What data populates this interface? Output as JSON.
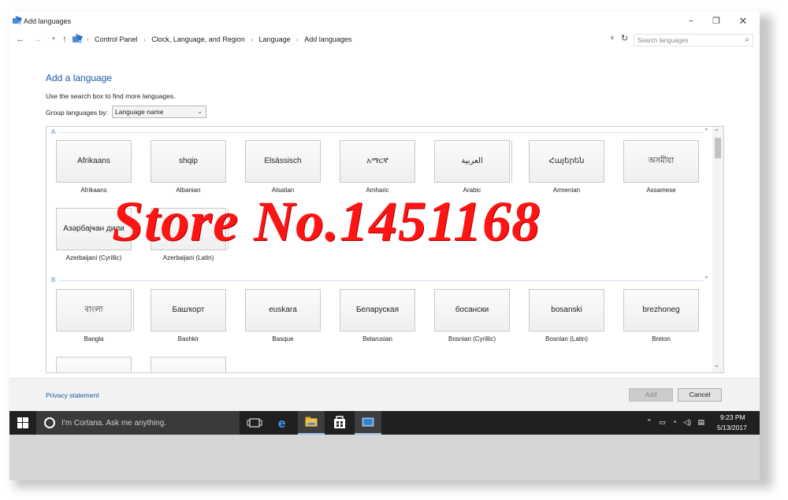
{
  "window": {
    "title": "Add languages",
    "controls": {
      "minimize": "−",
      "maximize": "❐",
      "close": "✕"
    }
  },
  "addressbar": {
    "back": "←",
    "forward": "→",
    "recent": "▾",
    "up": "↑",
    "breadcrumbs": [
      "Control Panel",
      "Clock, Language, and Region",
      "Language",
      "Add languages"
    ],
    "separator": "›",
    "dropdown": "∨",
    "refresh": "↻",
    "search_placeholder": "Search languages",
    "search_icon": "⌕"
  },
  "content": {
    "title": "Add a language",
    "hint": "Use the search box to find more languages.",
    "group_label": "Group languages by:",
    "group_value": "Language name",
    "group_dropdown": "⌄",
    "sections": [
      {
        "letter": "A",
        "collapse": "⌃",
        "languages": [
          {
            "native": "Afrikaans",
            "name": "Afrikaans"
          },
          {
            "native": "shqip",
            "name": "Albanian"
          },
          {
            "native": "Elsässisch",
            "name": "Alsatian"
          },
          {
            "native": "አማርኛ",
            "name": "Amharic"
          },
          {
            "native": "العربية",
            "name": "Arabic"
          },
          {
            "native": "Հայերեն",
            "name": "Armenian"
          },
          {
            "native": "অসমীয়া",
            "name": "Assamese"
          },
          {
            "native": "Азәрбајҹан дили",
            "name": "Azerbaijani (Cyrillic)"
          },
          {
            "native": "",
            "name": "Azerbaijani (Latin)"
          }
        ]
      },
      {
        "letter": "B",
        "collapse": "⌃",
        "languages": [
          {
            "native": "বাংলা",
            "name": "Bangla"
          },
          {
            "native": "Башҡорт",
            "name": "Bashkir"
          },
          {
            "native": "euskara",
            "name": "Basque"
          },
          {
            "native": "Беларуская",
            "name": "Belarusian"
          },
          {
            "native": "босански",
            "name": "Bosnian (Cyrillic)"
          },
          {
            "native": "bosanski",
            "name": "Bosnian (Latin)"
          },
          {
            "native": "brezhoneg",
            "name": "Breton"
          }
        ]
      }
    ],
    "scroll_up": "⌃",
    "scroll_down": "⌄"
  },
  "footer": {
    "privacy": "Privacy statement",
    "add": "Add",
    "cancel": "Cancel"
  },
  "taskbar": {
    "cortana_placeholder": "I'm Cortana. Ask me anything.",
    "tray_icons": [
      "⌃",
      "▭",
      "◔",
      "◁)",
      "▤"
    ],
    "time": "9:23 PM",
    "date": "5/13/2017"
  },
  "watermark": "Store No.1451168",
  "colors": {
    "accent": "#1a5aa6",
    "watermark": "#ff1414",
    "taskbar": "#202020"
  }
}
